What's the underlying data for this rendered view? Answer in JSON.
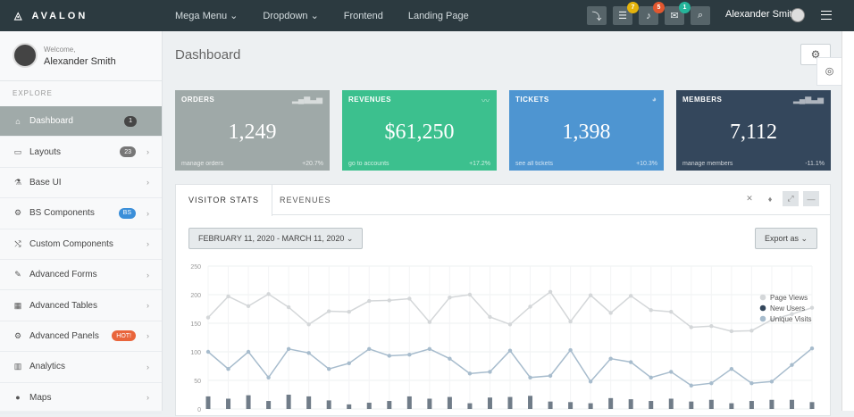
{
  "topbar": {
    "brand": "AVALON",
    "nav": [
      "Mega Menu ⌄",
      "Dropdown ⌄",
      "Frontend",
      "Landing Page"
    ],
    "badges": [
      "7",
      "5",
      "1"
    ],
    "user": "Alexander Smith"
  },
  "sidebar": {
    "welcome": "Welcome,",
    "name": "Alexander Smith",
    "section": "EXPLORE",
    "items": [
      {
        "label": "Dashboard",
        "icon": "home-icon",
        "badge": "1",
        "badge_color": "#464646"
      },
      {
        "label": "Layouts",
        "icon": "columns-icon",
        "badge": "23",
        "badge_color": "#777777"
      },
      {
        "label": "Base UI",
        "icon": "flask-icon"
      },
      {
        "label": "BS Components",
        "icon": "cogs-icon",
        "badge": "BS",
        "badge_color": "#3b8fd9"
      },
      {
        "label": "Custom Components",
        "icon": "random-icon"
      },
      {
        "label": "Advanced Forms",
        "icon": "pencil-icon"
      },
      {
        "label": "Advanced Tables",
        "icon": "table-icon"
      },
      {
        "label": "Advanced Panels",
        "icon": "gear-icon",
        "badge": "HOT!",
        "badge_color": "#e9653b"
      },
      {
        "label": "Analytics",
        "icon": "bar-chart-icon"
      },
      {
        "label": "Maps",
        "icon": "map-marker-icon"
      }
    ]
  },
  "page": {
    "title": "Dashboard"
  },
  "tiles": [
    {
      "label": "ORDERS",
      "value": "1,249",
      "footer": "manage orders",
      "pct": "+20.7%",
      "color": "#9fa9a8"
    },
    {
      "label": "REVENUES",
      "value": "$61,250",
      "footer": "go to accounts",
      "pct": "+17.2%",
      "color": "#3cc08e"
    },
    {
      "label": "TICKETS",
      "value": "1,398",
      "footer": "see all tickets",
      "pct": "+10.3%",
      "color": "#4e95d1"
    },
    {
      "label": "MEMBERS",
      "value": "7,112",
      "footer": "manage members",
      "pct": "-11.1%",
      "color": "#34475c"
    }
  ],
  "panel": {
    "tabs": [
      "VISITOR STATS",
      "REVENUES"
    ],
    "date_range": "FEBRUARY 11, 2020 - MARCH 11, 2020 ⌄",
    "export": "Export as ⌄"
  },
  "chart_data": {
    "type": "line",
    "ylim": [
      0,
      250
    ],
    "yticks": [
      "250",
      "200",
      "150",
      "100",
      "50",
      "0"
    ],
    "series": [
      {
        "name": "Page Views",
        "color": "#d4d7d9",
        "values": [
          160,
          197,
          180,
          201,
          178,
          148,
          171,
          170,
          189,
          190,
          193,
          152,
          195,
          200,
          161,
          148,
          179,
          205,
          153,
          199,
          168,
          198,
          173,
          170,
          143,
          145,
          136,
          137,
          156,
          166,
          177
        ]
      },
      {
        "name": "New Users",
        "color": "#34475c",
        "values": [
          22,
          18,
          24,
          14,
          25,
          22,
          15,
          8,
          11,
          14,
          22,
          18,
          21,
          10,
          20,
          21,
          23,
          13,
          12,
          10,
          19,
          17,
          14,
          18,
          13,
          16,
          10,
          14,
          16,
          16,
          12
        ]
      },
      {
        "name": "Unique Visits",
        "color": "#a7bccd",
        "values": [
          100,
          70,
          100,
          55,
          105,
          98,
          70,
          80,
          105,
          93,
          95,
          105,
          88,
          62,
          65,
          102,
          55,
          58,
          103,
          48,
          88,
          82,
          55,
          65,
          41,
          45,
          70,
          45,
          48,
          77,
          106
        ]
      }
    ]
  }
}
